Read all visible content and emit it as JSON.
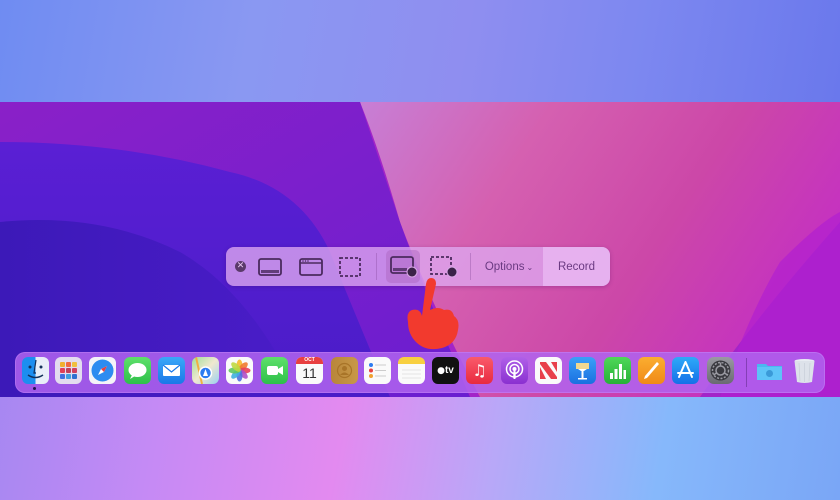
{
  "screenshot_toolbar": {
    "close_icon": "close-circle-icon",
    "modes": [
      {
        "name": "capture-entire-screen",
        "icon": "screen-icon",
        "selected": false
      },
      {
        "name": "capture-selected-window",
        "icon": "window-icon",
        "selected": false
      },
      {
        "name": "capture-selected-portion",
        "icon": "dashed-selection-icon",
        "selected": false
      },
      {
        "name": "record-entire-screen",
        "icon": "screen-record-icon",
        "selected": true
      },
      {
        "name": "record-selected-portion",
        "icon": "dashed-record-icon",
        "selected": false
      }
    ],
    "options_label": "Options",
    "options_chevron": "⌄",
    "record_label": "Record"
  },
  "cursor": {
    "icon": "pointing-hand-icon",
    "color": "#f23a2e"
  },
  "dock": {
    "apps": [
      {
        "name": "Finder",
        "running": true
      },
      {
        "name": "Launchpad"
      },
      {
        "name": "Safari"
      },
      {
        "name": "Messages"
      },
      {
        "name": "Mail"
      },
      {
        "name": "Maps"
      },
      {
        "name": "Photos"
      },
      {
        "name": "FaceTime"
      },
      {
        "name": "Calendar",
        "month": "OCT",
        "day": "11"
      },
      {
        "name": "Contacts"
      },
      {
        "name": "Reminders"
      },
      {
        "name": "Notes"
      },
      {
        "name": "TV",
        "label": "tv"
      },
      {
        "name": "Music"
      },
      {
        "name": "Podcasts"
      },
      {
        "name": "News"
      },
      {
        "name": "Keynote"
      },
      {
        "name": "Numbers"
      },
      {
        "name": "Pages"
      },
      {
        "name": "App Store"
      },
      {
        "name": "System Preferences"
      }
    ],
    "stacks": [
      {
        "name": "Downloads"
      },
      {
        "name": "Trash"
      }
    ]
  }
}
